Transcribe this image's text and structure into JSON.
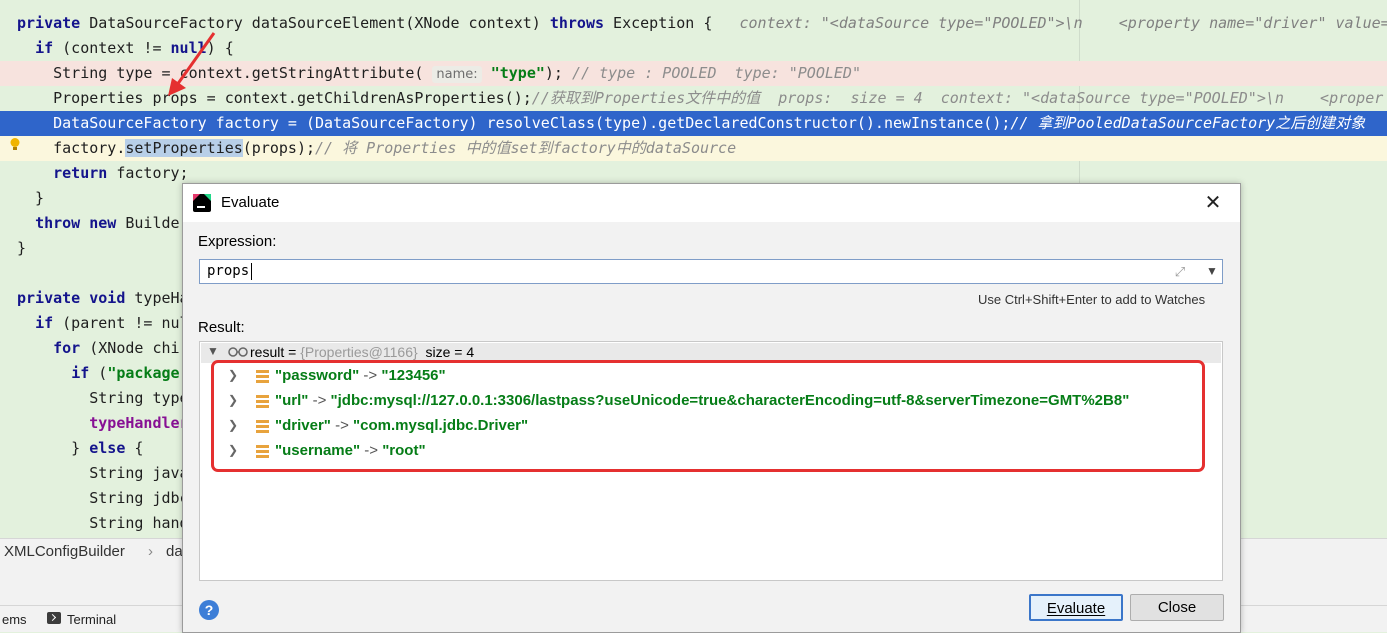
{
  "editor": {
    "lines": [
      {
        "tokens": [
          {
            "t": "private ",
            "c": "kw"
          },
          {
            "t": "DataSourceFactory dataSourceElement(XNode context) "
          },
          {
            "t": "throws ",
            "c": "kw"
          },
          {
            "t": "Exception {   "
          },
          {
            "t": "context: \"<dataSource type=\"POOLED\">\\n    <property name=\"driver\" value=\"",
            "c": "hint"
          }
        ]
      },
      {
        "tokens": [
          {
            "t": "  "
          },
          {
            "t": "if ",
            "c": "kw"
          },
          {
            "t": "(context != "
          },
          {
            "t": "null",
            "c": "kw"
          },
          {
            "t": ") {"
          }
        ]
      },
      {
        "tokens": [
          {
            "t": "    String type = context.getStringAttribute( "
          },
          {
            "t": "name:",
            "c": "param"
          },
          {
            "t": " "
          },
          {
            "t": "\"type\"",
            "c": "str"
          },
          {
            "t": "); "
          },
          {
            "t": "// type : POOLED  type: \"POOLED\"",
            "c": "cm"
          }
        ]
      },
      {
        "tokens": [
          {
            "t": "    Properties props = context.getChildrenAsProperties();"
          },
          {
            "t": "//获取到Properties文件中的值  props:  size = 4  context: \"<dataSource type=\"POOLED\">\\n    <proper",
            "c": "cm"
          }
        ]
      },
      {
        "tokens": [
          {
            "t": "    DataSourceFactory factory = (DataSourceFactory) resolveClass(type).getDeclaredConstructor().newInstance();"
          },
          {
            "t": "// 拿到PooledDataSourceFactory之后创建对象",
            "c": "cm"
          }
        ]
      },
      {
        "tokens": [
          {
            "t": "    factory."
          },
          {
            "t": "setPropert",
            "c": "ident-hl"
          },
          {
            "t": "ies",
            "c": "ident-hl"
          },
          {
            "t": "(props);"
          },
          {
            "t": "// 将 Properties 中的值set到factory中的dataSource",
            "c": "cm"
          }
        ]
      },
      {
        "tokens": [
          {
            "t": "    "
          },
          {
            "t": "return ",
            "c": "kw"
          },
          {
            "t": "factory;"
          }
        ]
      },
      {
        "tokens": [
          {
            "t": "  }"
          }
        ]
      },
      {
        "tokens": [
          {
            "t": "  "
          },
          {
            "t": "throw new ",
            "c": "kw"
          },
          {
            "t": "Builde"
          }
        ]
      },
      {
        "tokens": [
          {
            "t": "}"
          }
        ]
      },
      {
        "tokens": [
          {
            "t": ""
          }
        ]
      },
      {
        "tokens": [
          {
            "t": "private void ",
            "c": "kw"
          },
          {
            "t": "typeHa"
          }
        ]
      },
      {
        "tokens": [
          {
            "t": "  "
          },
          {
            "t": "if ",
            "c": "kw"
          },
          {
            "t": "(parent != nul"
          }
        ]
      },
      {
        "tokens": [
          {
            "t": "    "
          },
          {
            "t": "for ",
            "c": "kw"
          },
          {
            "t": "(XNode chi"
          }
        ]
      },
      {
        "tokens": [
          {
            "t": "      "
          },
          {
            "t": "if ",
            "c": "kw"
          },
          {
            "t": "("
          },
          {
            "t": "\"package",
            "c": "str"
          }
        ]
      },
      {
        "tokens": [
          {
            "t": "        String type"
          }
        ]
      },
      {
        "tokens": [
          {
            "t": "        "
          },
          {
            "t": "typeHandler",
            "c": "purple"
          }
        ]
      },
      {
        "tokens": [
          {
            "t": "      } "
          },
          {
            "t": "else ",
            "c": "kw"
          },
          {
            "t": "{"
          }
        ]
      },
      {
        "tokens": [
          {
            "t": "        String java"
          }
        ]
      },
      {
        "tokens": [
          {
            "t": "        String jdbc"
          }
        ]
      },
      {
        "tokens": [
          {
            "t": "        String hand"
          }
        ]
      }
    ]
  },
  "breadcrumb": {
    "class_name": "XMLConfigBuilder",
    "separator": "›",
    "method": "da"
  },
  "toolstrip": {
    "problems": "ems",
    "terminal": "Terminal"
  },
  "dialog": {
    "title": "Evaluate",
    "close_glyph": "✕",
    "expression_label": "Expression:",
    "expression_value": "props",
    "watches_hint": "Use Ctrl+Shift+Enter to add to Watches",
    "result_label": "Result:",
    "result_header": {
      "name": "result = ",
      "type": "{Properties@1166}",
      "size": "  size = 4"
    },
    "entries": [
      {
        "key": "\"password\"",
        "value": "\"123456\""
      },
      {
        "key": "\"url\"",
        "value": "\"jdbc:mysql://127.0.0.1:3306/lastpass?useUnicode=true&characterEncoding=utf-8&serverTimezone=GMT%2B8\""
      },
      {
        "key": "\"driver\"",
        "value": "\"com.mysql.jdbc.Driver\""
      },
      {
        "key": "\"username\"",
        "value": "\"root\""
      }
    ],
    "arrow": " -> ",
    "help_glyph": "?",
    "evaluate_label": "Evaluate",
    "close_label": "Close"
  },
  "colors": {
    "editor_bg": "#e3f1dd",
    "selection": "#2f65ca",
    "annotation_red": "#e53030",
    "string_green": "#067d17",
    "keyword_blue": "#14148c"
  }
}
